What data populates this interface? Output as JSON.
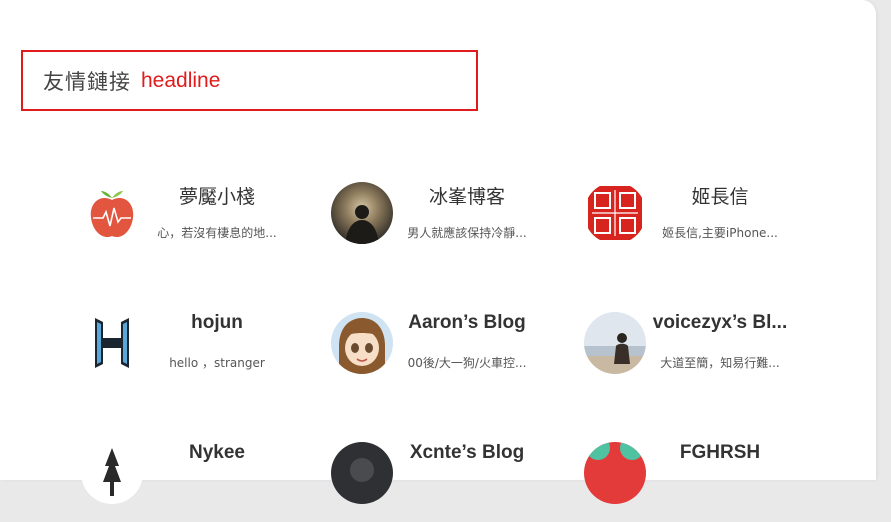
{
  "section": {
    "title": "友情鏈接",
    "tag": "headline"
  },
  "links": [
    {
      "name": "夢魘小棧",
      "desc": "心，若沒有棲息的地...",
      "avatar_icon": "apple-icon"
    },
    {
      "name": "冰峯博客",
      "desc": "男人就應該保持冷靜...",
      "avatar_icon": "person-silhouette-icon"
    },
    {
      "name": "姬長信",
      "desc": "姬長信,主要iPhone...",
      "avatar_icon": "red-seal-icon",
      "seal_text": "信姬印長"
    },
    {
      "name": "hojun",
      "desc": "hello ，stranger",
      "avatar_icon": "h-logo-icon"
    },
    {
      "name": "Aaron’s Blog",
      "desc": "00後/大一狗/火車控...",
      "avatar_icon": "anime-girl-icon"
    },
    {
      "name": "voicezyx’s Bl...",
      "desc": "大道至簡，知易行難...",
      "avatar_icon": "beach-person-icon"
    },
    {
      "name": "Nykee",
      "desc": "",
      "avatar_icon": "tree-icon"
    },
    {
      "name": "Xcnte’s Blog",
      "desc": "",
      "avatar_icon": "dark-avatar-icon"
    },
    {
      "name": "FGHRSH",
      "desc": "",
      "avatar_icon": "colorful-avatar-icon"
    }
  ],
  "colors": {
    "accent": "#e01b1b",
    "background": "#ffffff",
    "page_background": "#e9e9ea"
  }
}
